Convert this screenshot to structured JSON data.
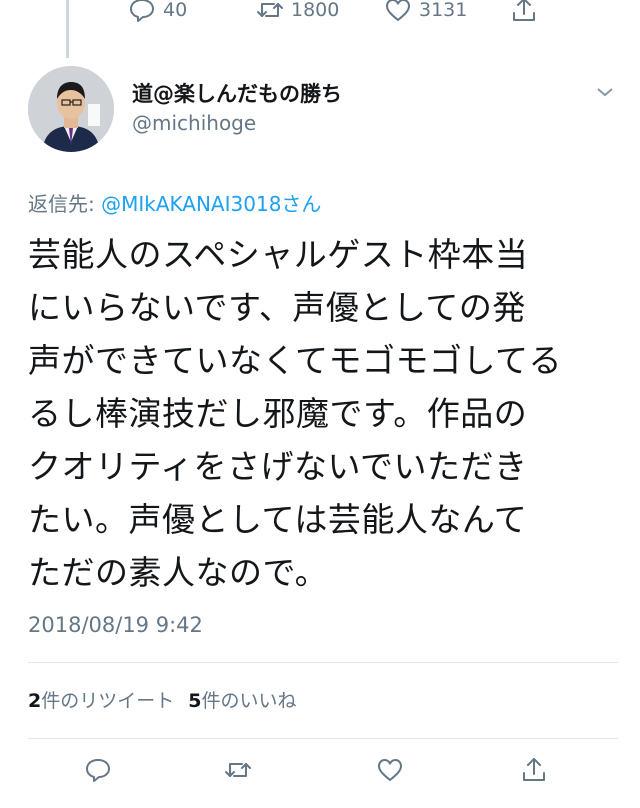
{
  "previous_tweet_actions": {
    "reply_count": "40",
    "retweet_count": "1800",
    "like_count": "3131"
  },
  "tweet": {
    "display_name": "道@楽しんだもの勝ち",
    "handle": "@michihoge",
    "reply_prefix": "返信先: ",
    "reply_mention": "@MIkAKANAI3018さん",
    "text_lines": [
      "芸能人のスペシャルゲスト枠本当",
      "にいらないです、声優としての発",
      "声ができていなくてモゴモゴしてる",
      "るし棒演技だし邪魔です。作品の",
      "クオリティをさげないでいただき",
      "たい。声優としては芸能人なんて",
      "ただの素人なので。"
    ],
    "timestamp": "2018/08/19 9:42"
  },
  "stats": {
    "retweet_number": "2",
    "retweet_label": "件のリツイート",
    "like_number": "5",
    "like_label": "件のいいね"
  },
  "icons": {
    "reply": "speech-bubble-icon",
    "retweet": "retweet-arrows-icon",
    "like": "heart-icon",
    "share": "share-upload-icon",
    "more": "chevron-down-icon"
  },
  "colors": {
    "link": "#1da1f2",
    "secondary_text": "#657786",
    "primary_text": "#14171a",
    "divider": "#e1e8ed"
  }
}
